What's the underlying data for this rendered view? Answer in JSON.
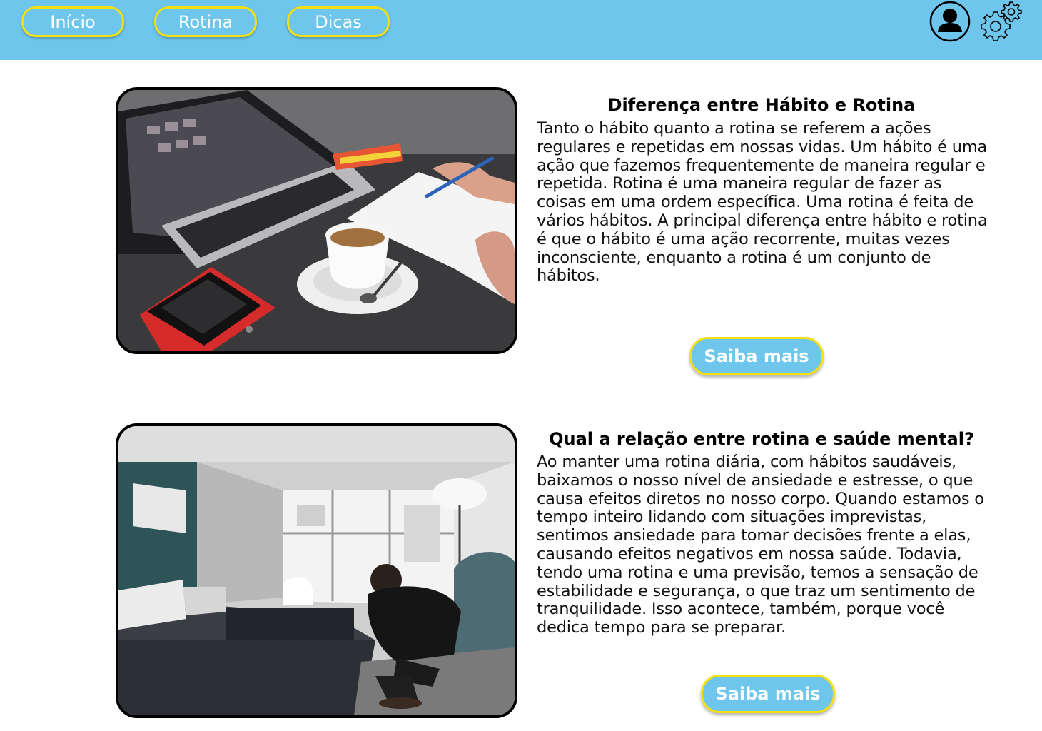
{
  "nav": {
    "items": [
      {
        "label": "Início"
      },
      {
        "label": "Rotina"
      },
      {
        "label": "Dicas"
      }
    ]
  },
  "icons": {
    "profile": "user-profile-icon",
    "settings": "gear-icon"
  },
  "colors": {
    "header_bg": "#6ec6ec",
    "button_border": "#f4e012",
    "button_text": "#ffffff"
  },
  "articles": [
    {
      "title": "Diferença entre Hábito e Rotina",
      "body": "Tanto o hábito quanto a rotina se referem a ações regulares e repetidas em nossas vidas. Um hábito é uma ação que fazemos frequentemente de maneira regular e repetida. Rotina é uma maneira regular de fazer as coisas em uma ordem específica. Uma rotina é feita de vários hábitos. A principal diferença entre hábito e rotina é que o hábito é uma ação recorrente, muitas vezes inconsciente, enquanto a rotina é um conjunto de hábitos.",
      "button_label": "Saiba mais",
      "image": "laptop-coffee-desk-photo"
    },
    {
      "title": "Qual a relação entre rotina e saúde mental?",
      "body": "Ao manter uma rotina diária, com hábitos saudáveis, baixamos o nosso nível de ansiedade e estresse, o que causa efeitos diretos no nosso corpo. Quando estamos o tempo inteiro lidando com situações imprevistas, sentimos ansiedade para tomar decisões frente a elas, causando efeitos negativos em nossa saúde. Todavia, tendo uma rotina e uma previsão, temos a sensação de estabilidade e segurança, o que traz um sentimento de tranquilidade. Isso acontece, também, porque você dedica tempo para se preparar.",
      "button_label": "Saiba mais",
      "image": "bedroom-man-tying-shoes-photo"
    }
  ]
}
